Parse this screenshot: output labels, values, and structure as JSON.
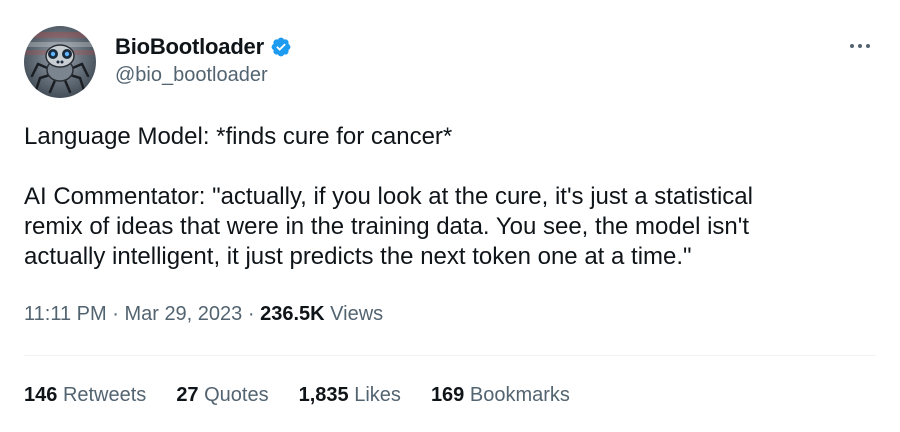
{
  "author": {
    "display_name": "BioBootloader",
    "handle": "@bio_bootloader",
    "verified": true,
    "avatar_icon": "robot-spider-avatar"
  },
  "tweet": {
    "paragraphs": [
      "Language Model: *finds cure for cancer*",
      "AI Commentator: \"actually, if you look at the cure, it's just a statistical\nremix of ideas that were in the training data. You see, the model isn't\nactually intelligent, it just predicts the next token one at a time.\""
    ]
  },
  "meta": {
    "time": "11:11 PM",
    "separator": "·",
    "date": "Mar 29, 2023",
    "views_count": "236.5K",
    "views_label": "Views"
  },
  "stats": {
    "retweets": {
      "count": "146",
      "label": "Retweets"
    },
    "quotes": {
      "count": "27",
      "label": "Quotes"
    },
    "likes": {
      "count": "1,835",
      "label": "Likes"
    },
    "bookmarks": {
      "count": "169",
      "label": "Bookmarks"
    }
  },
  "colors": {
    "text": "#0f1419",
    "secondary": "#536471",
    "verified_blue": "#1d9bf0",
    "divider": "#eff3f4"
  }
}
